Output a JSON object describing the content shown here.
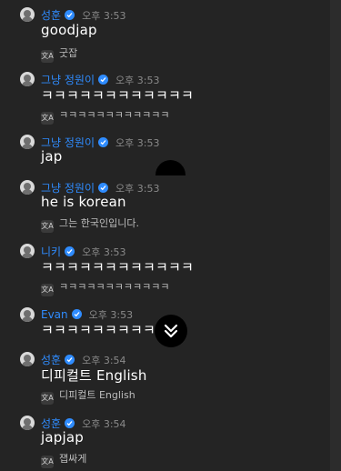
{
  "translate_icon": "translate-icon",
  "colors": {
    "background": "#242424",
    "name": "#2f8cff",
    "time": "#8a8a8a",
    "translation": "#bdbdbd"
  },
  "messages": [
    {
      "author": "성훈",
      "time": "오후 3:53",
      "text": "goodjap",
      "translation": "굿잡"
    },
    {
      "author": "그냥 정원이",
      "time": "오후 3:53",
      "text": "ㅋㅋㅋㅋㅋㅋㅋㅋㅋㅋㅋㅋ",
      "translation": "ㅋㅋㅋㅋㅋㅋㅋㅋㅋㅋㅋㅋ"
    },
    {
      "author": "그냥 정원이",
      "time": "오후 3:53",
      "text": "jap"
    },
    {
      "author": "그냥 정원이",
      "time": "오후 3:53",
      "text": "he is korean",
      "translation": "그는 한국인입니다."
    },
    {
      "author": "니키",
      "time": "오후 3:53",
      "text": "ㅋㅋㅋㅋㅋㅋㅋㅋㅋㅋㅋㅋ",
      "translation": "ㅋㅋㅋㅋㅋㅋㅋㅋㅋㅋㅋㅋ"
    },
    {
      "author": "Evan",
      "time": "오후 3:53",
      "text": "ㅋㅋㅋㅋㅋㅋㅋㅋㅋ"
    },
    {
      "author": "성훈",
      "time": "오후 3:54",
      "text": "디피컬트 English",
      "translation": "디피컬트 English"
    },
    {
      "author": "성훈",
      "time": "오후 3:54",
      "text": "japjap",
      "translation": "잽싸게"
    }
  ]
}
